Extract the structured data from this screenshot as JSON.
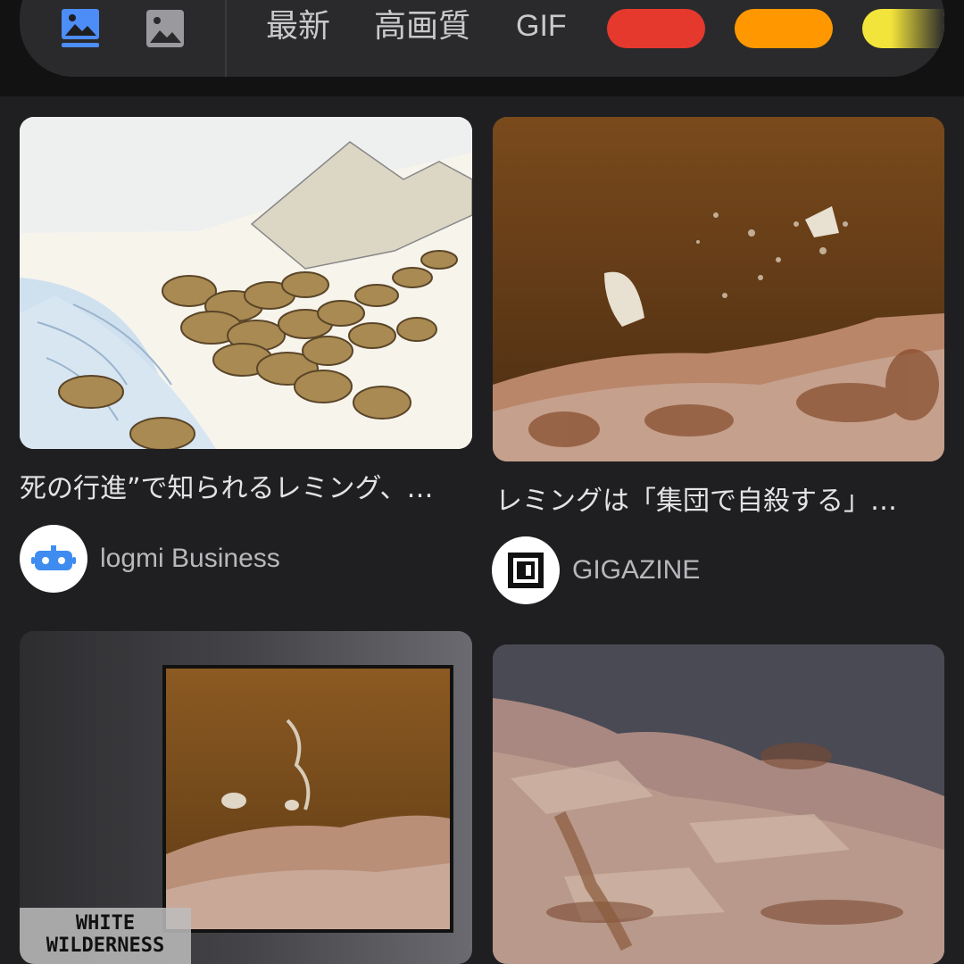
{
  "filter_bar": {
    "chips": [
      {
        "label": "最新"
      },
      {
        "label": "高画質"
      },
      {
        "label": "GIF"
      }
    ],
    "color_chips": [
      "#e5392e",
      "#ff9800",
      "#f3e43b"
    ],
    "accent": "#4d8df7"
  },
  "results": [
    {
      "caption": "死の行進”で知られるレミング、…",
      "source": "logmi Business",
      "source_icon": "robot-logo-icon"
    },
    {
      "caption": "レミングは「集団で自殺する」…",
      "source": "GIGAZINE",
      "source_icon": "gigazine-logo-icon"
    },
    {
      "caption": "",
      "source": "",
      "overlay_text": [
        "WHITE",
        "WILDERNESS"
      ]
    },
    {
      "caption": "",
      "source": ""
    }
  ]
}
